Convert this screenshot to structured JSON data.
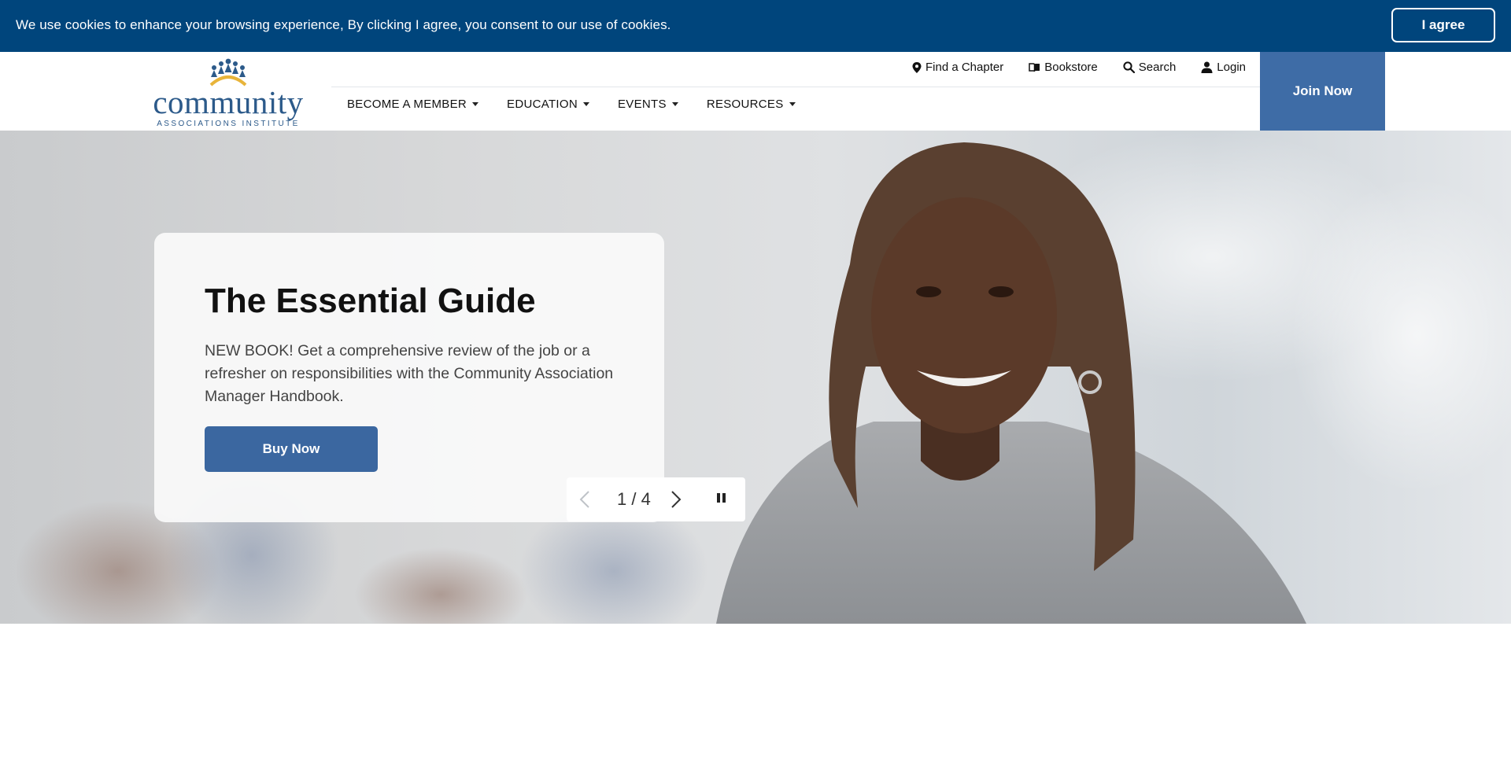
{
  "cookie_banner": {
    "message": "We use cookies to enhance your browsing experience, By clicking I agree, you consent to our use of cookies.",
    "agree_label": "I agree"
  },
  "logo": {
    "word": "community",
    "subtitle": "ASSOCIATIONS INSTITUTE"
  },
  "utility_nav": {
    "find_chapter": "Find a Chapter",
    "bookstore": "Bookstore",
    "search": "Search",
    "login": "Login"
  },
  "main_nav": {
    "become_member": "BECOME A MEMBER",
    "education": "EDUCATION",
    "events": "EVENTS",
    "resources": "RESOURCES"
  },
  "join_label": "Join Now",
  "hero": {
    "title": "The Essential Guide",
    "description": "NEW BOOK! Get a comprehensive review of the job or a refresher on responsibilities with the Community Association Manager Handbook.",
    "cta_label": "Buy Now",
    "slide_counter": "1 / 4"
  },
  "colors": {
    "cookie_bg": "#00457c",
    "brand_blue": "#3e6ca6",
    "button_blue": "#3b67a0",
    "logo_gold": "#e8b43a"
  }
}
